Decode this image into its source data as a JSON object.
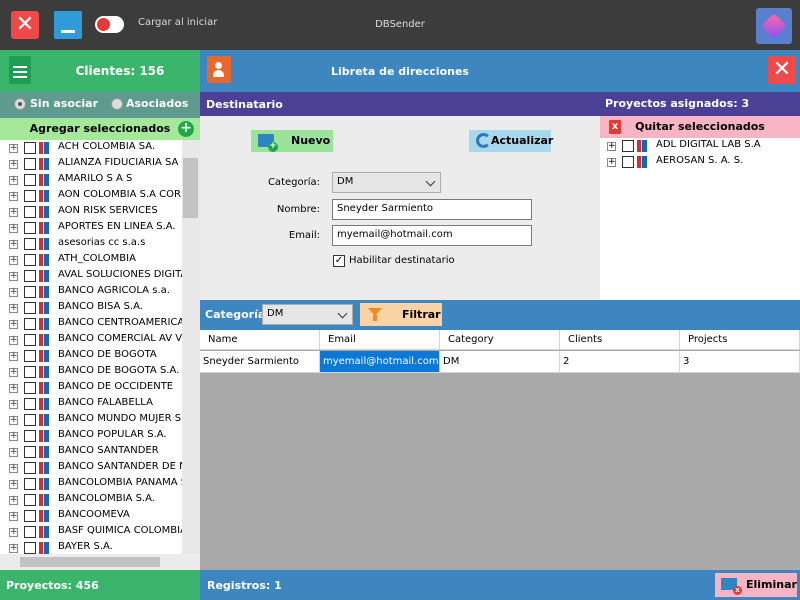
{
  "window": {
    "title": "DBSender",
    "close_symbol": "✕",
    "startup_toggle_label": "Cargar al iniciar",
    "startup_toggle_on": false
  },
  "left": {
    "clients_label": "Clientes: 156",
    "filters": [
      {
        "label": "Sin asociar",
        "selected": true
      },
      {
        "label": "Asociados",
        "selected": false
      }
    ],
    "add_selected_label": "Agregar seleccionados",
    "add_symbol": "+",
    "expand_symbol": "+",
    "clients": [
      "ACH COLOMBIA SA.",
      "ALIANZA FIDUCIARIA  SA",
      "AMARILO S A S",
      "AON COLOMBIA S.A CORREDORES",
      "AON RISK SERVICES",
      "APORTES EN LINEA S.A.",
      "asesorias cc s.a.s",
      "ATH_COLOMBIA",
      "AVAL SOLUCIONES DIGITALES",
      "BANCO AGRICOLA s.a.",
      "BANCO BISA S.A.",
      "BANCO CENTROAMERICANO",
      "BANCO COMERCIAL AV VILLAS",
      "BANCO DE BOGOTA",
      "BANCO DE BOGOTA S.A.",
      "BANCO DE OCCIDENTE",
      "BANCO FALABELLA",
      "BANCO MUNDO MUJER S.",
      "BANCO POPULAR S.A.",
      "BANCO SANTANDER",
      "BANCO SANTANDER DE N",
      "BANCOLOMBIA PANAMA SA",
      "BANCOLOMBIA S.A.",
      "BANCOOMEVA",
      "BASF QUIMICA COLOMBIA S",
      "BAYER S.A."
    ],
    "projects_label": "Proyectos: 456"
  },
  "main": {
    "title": "Libreta de direcciones",
    "close_symbol": "✕",
    "recipient_header": "Destinatario",
    "new_button": "Nuevo",
    "refresh_button": "Actualizar",
    "form": {
      "category_label": "Categoría:",
      "category_value": "DM",
      "name_label": "Nombre:",
      "name_value": "Sneyder Sarmiento",
      "email_label": "Email:",
      "email_value": "myemail@hotmail.com",
      "enable_label": "Habilitar destinatario",
      "enable_checked": true,
      "check_symbol": "✓"
    },
    "filter": {
      "label": "Categoría",
      "value": "DM",
      "button": "Filtrar"
    },
    "table": {
      "columns": [
        "Name",
        "Email",
        "Category",
        "Clients",
        "Projects"
      ],
      "rows": [
        [
          "Sneyder Sarmiento",
          "myemail@hotmail.com",
          "DM",
          "2",
          "3"
        ]
      ]
    },
    "records_label": "Registros: 1",
    "delete_button": "Eliminar"
  },
  "projects": {
    "assigned_label": "Proyectos asignados: 3",
    "remove_selected_label": "Quitar seleccionados",
    "remove_symbol": "x",
    "items": [
      "ADL DIGITAL LAB S.A",
      "AEROSAN S. A. S."
    ]
  },
  "colors": {
    "green": "#3bb56b",
    "blue": "#3d86c0",
    "purple": "#4b3f96",
    "selection": "#0a78d7",
    "close_red": "#ef4a49"
  }
}
